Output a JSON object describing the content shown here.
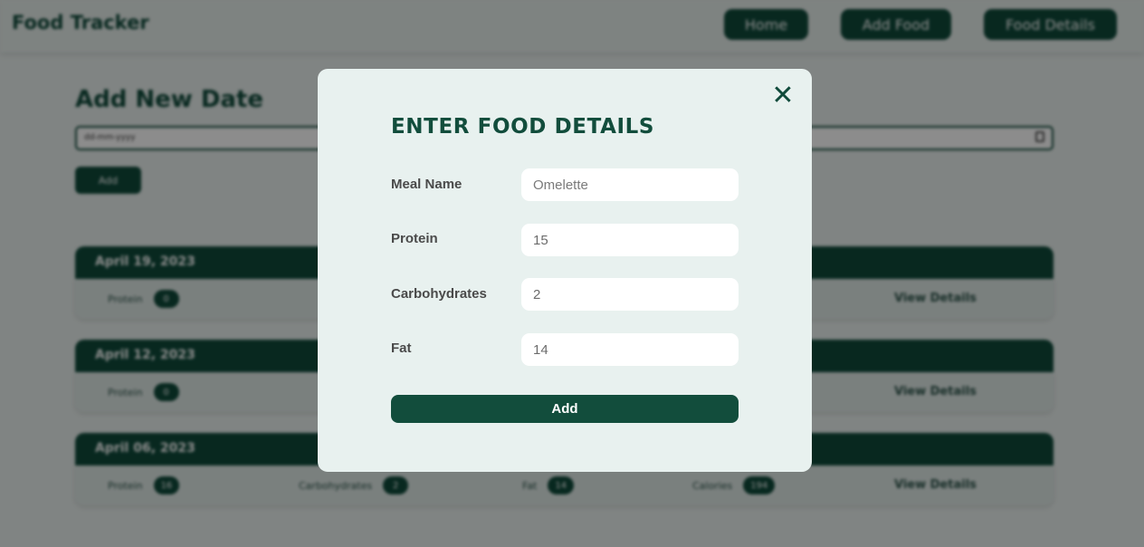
{
  "navbar": {
    "logo": "Food Tracker",
    "links": [
      "Home",
      "Add Food",
      "Food Details"
    ]
  },
  "add_date": {
    "title": "Add New Date",
    "input_placeholder": "dd-mm-yyyy",
    "button_label": "Add"
  },
  "date_cards": [
    {
      "date": "April 19, 2023",
      "stats": [
        {
          "label": "Protein",
          "value": "0"
        }
      ],
      "link": "View Details"
    },
    {
      "date": "April 12, 2023",
      "stats": [
        {
          "label": "Protein",
          "value": "0"
        }
      ],
      "link": "View Details"
    },
    {
      "date": "April 06, 2023",
      "stats": [
        {
          "label": "Protein",
          "value": "16"
        },
        {
          "label": "Carbohydrates",
          "value": "2"
        },
        {
          "label": "Fat",
          "value": "14"
        },
        {
          "label": "Calories",
          "value": "194"
        }
      ],
      "link": "View Details"
    }
  ],
  "modal": {
    "close_symbol": "✕",
    "title": "ENTER FOOD DETAILS",
    "fields": [
      {
        "label": "Meal Name",
        "value": "",
        "placeholder": "Omelette"
      },
      {
        "label": "Protein",
        "value": "15",
        "placeholder": ""
      },
      {
        "label": "Carbohydrates",
        "value": "2",
        "placeholder": ""
      },
      {
        "label": "Fat",
        "value": "14",
        "placeholder": ""
      }
    ],
    "submit_label": "Add"
  },
  "colors": {
    "primary": "#124d3c",
    "modal_bg": "#e8f1ef",
    "overlay": "rgba(0,0,0,0.45)"
  }
}
